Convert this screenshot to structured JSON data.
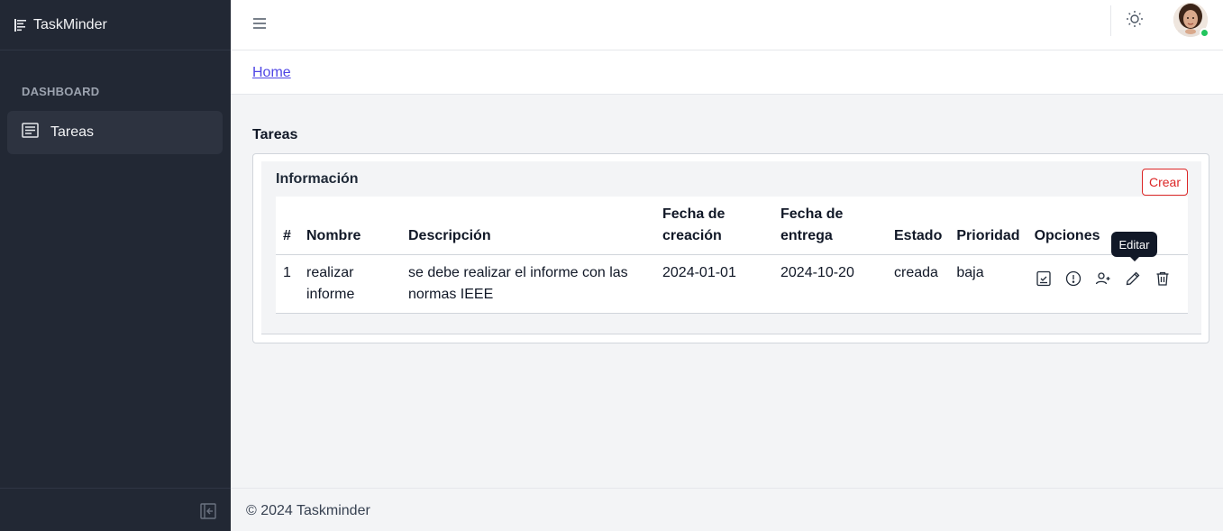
{
  "app": {
    "name": "TaskMinder"
  },
  "sidebar": {
    "section_label": "DASHBOARD",
    "items": [
      {
        "label": "Tareas",
        "icon": "list-document-icon",
        "active": true
      }
    ]
  },
  "topbar": {
    "menu_icon": "hamburger-icon",
    "theme_icon": "sun-icon",
    "online": true
  },
  "breadcrumb": {
    "home": "Home"
  },
  "page": {
    "title": "Tareas"
  },
  "card": {
    "title": "Información",
    "create_label": "Crear",
    "table": {
      "headers": [
        "#",
        "Nombre",
        "Descripción",
        "Fecha de creación",
        "Fecha de entrega",
        "Estado",
        "Prioridad",
        "Opciones"
      ],
      "rows": [
        {
          "num": "1",
          "nombre": "realizar informe",
          "descripcion": "se debe realizar el informe con las normas IEEE",
          "fecha_creacion": "2024-01-01",
          "fecha_entrega": "2024-10-20",
          "estado": "creada",
          "prioridad": "baja"
        }
      ],
      "option_icons": [
        "checklist-icon",
        "alert-circle-icon",
        "add-user-icon",
        "pencil-icon",
        "trash-icon"
      ]
    },
    "tooltip": "Editar"
  },
  "footer": {
    "text": "© 2024 Taskminder"
  },
  "colors": {
    "sidebar_bg": "#222834",
    "accent_red": "#dc2626",
    "link": "#4f46e5",
    "online": "#22c55e"
  }
}
